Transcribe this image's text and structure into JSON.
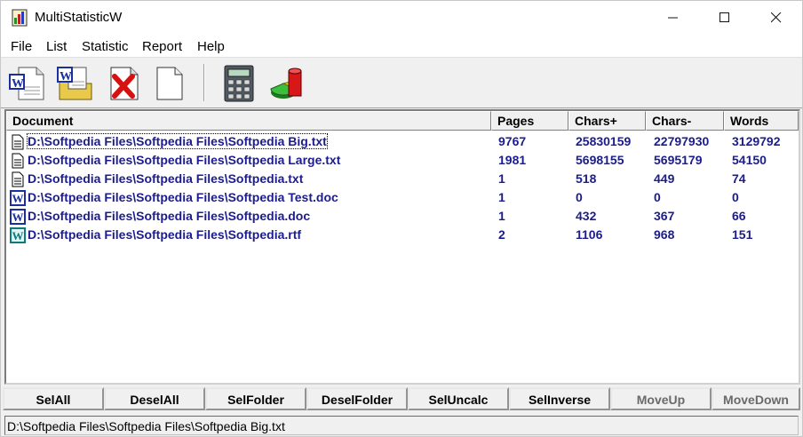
{
  "window": {
    "title": "MultiStatisticW"
  },
  "menu": [
    "File",
    "List",
    "Statistic",
    "Report",
    "Help"
  ],
  "toolbar": {
    "icons": [
      "word-add-file-icon",
      "word-add-folder-icon",
      "remove-file-icon",
      "new-list-icon",
      "calculator-icon",
      "statistics-chart-icon"
    ]
  },
  "table": {
    "columns": [
      "Document",
      "Pages",
      "Chars+",
      "Chars-",
      "Words"
    ],
    "rows": [
      {
        "icon": "text-file-icon",
        "document": "D:\\Softpedia Files\\Softpedia Files\\Softpedia Big.txt",
        "pages": "9767",
        "chars_plus": "25830159",
        "chars_minus": "22797930",
        "words": "3129792"
      },
      {
        "icon": "text-file-icon",
        "document": "D:\\Softpedia Files\\Softpedia Files\\Softpedia Large.txt",
        "pages": "1981",
        "chars_plus": "5698155",
        "chars_minus": "5695179",
        "words": "54150"
      },
      {
        "icon": "text-file-icon",
        "document": "D:\\Softpedia Files\\Softpedia Files\\Softpedia.txt",
        "pages": "1",
        "chars_plus": "518",
        "chars_minus": "449",
        "words": "74"
      },
      {
        "icon": "word-doc-icon",
        "document": "D:\\Softpedia Files\\Softpedia Files\\Softpedia Test.doc",
        "pages": "1",
        "chars_plus": "0",
        "chars_minus": "0",
        "words": "0"
      },
      {
        "icon": "word-doc-icon",
        "document": "D:\\Softpedia Files\\Softpedia Files\\Softpedia.doc",
        "pages": "1",
        "chars_plus": "432",
        "chars_minus": "367",
        "words": "66"
      },
      {
        "icon": "rtf-doc-icon",
        "document": "D:\\Softpedia Files\\Softpedia Files\\Softpedia.rtf",
        "pages": "2",
        "chars_plus": "1106",
        "chars_minus": "968",
        "words": "151"
      }
    ]
  },
  "buttons": [
    "SelAll",
    "DeselAll",
    "SelFolder",
    "DeselFolder",
    "SelUncalc",
    "SelInverse",
    "MoveUp",
    "MoveDown"
  ],
  "status": {
    "text": "D:\\Softpedia Files\\Softpedia Files\\Softpedia Big.txt"
  },
  "colors": {
    "row_text": "#1c1c8c",
    "window_bg": "#f0f0f0"
  }
}
